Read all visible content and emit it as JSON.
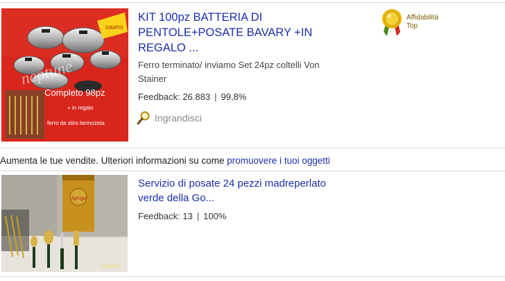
{
  "listing1": {
    "image_texts": {
      "watermark": "neptune",
      "line1": "Completo 98pz",
      "line2": "+ in regalo",
      "line3": "ferro da stiro termozeta"
    },
    "title_line1": "KIT 100pz BATTERIA DI",
    "title_line2": "PENTOLE+POSATE BAVARY +IN",
    "title_line3": "REGALO ...",
    "subtitle_line1": "Ferro terminato/ inviamo Set 24pz coltelli Von",
    "subtitle_line2": "Stainer",
    "feedback_label": "Feedback: 26.883",
    "feedback_sep": "|",
    "feedback_percent": "99,8%",
    "enlarge_label": "Ingrandisci",
    "enlarge_icon": "magnifier-icon",
    "badge_icon": "top-rated-seller-medal-icon",
    "badge_line1": "Affidabilità",
    "badge_line2": "Top"
  },
  "promo": {
    "text": "Aumenta le tue vendite. Ulteriori informazioni su come ",
    "link": "promuovere i tuoi oggetti"
  },
  "listing2": {
    "image_texts": {
      "box_text": "Aprigo",
      "timestamp": "10/01/2009"
    },
    "title_line1": "Servizio di posate 24 pezzi madreperlato",
    "title_line2": "verde della Go...",
    "feedback_label": "Feedback: 13",
    "feedback_sep": "|",
    "feedback_percent": "100%"
  },
  "colors": {
    "link": "#1a2fa8",
    "image1_background": "#d8261c",
    "badge_gold": "#e8b400"
  }
}
